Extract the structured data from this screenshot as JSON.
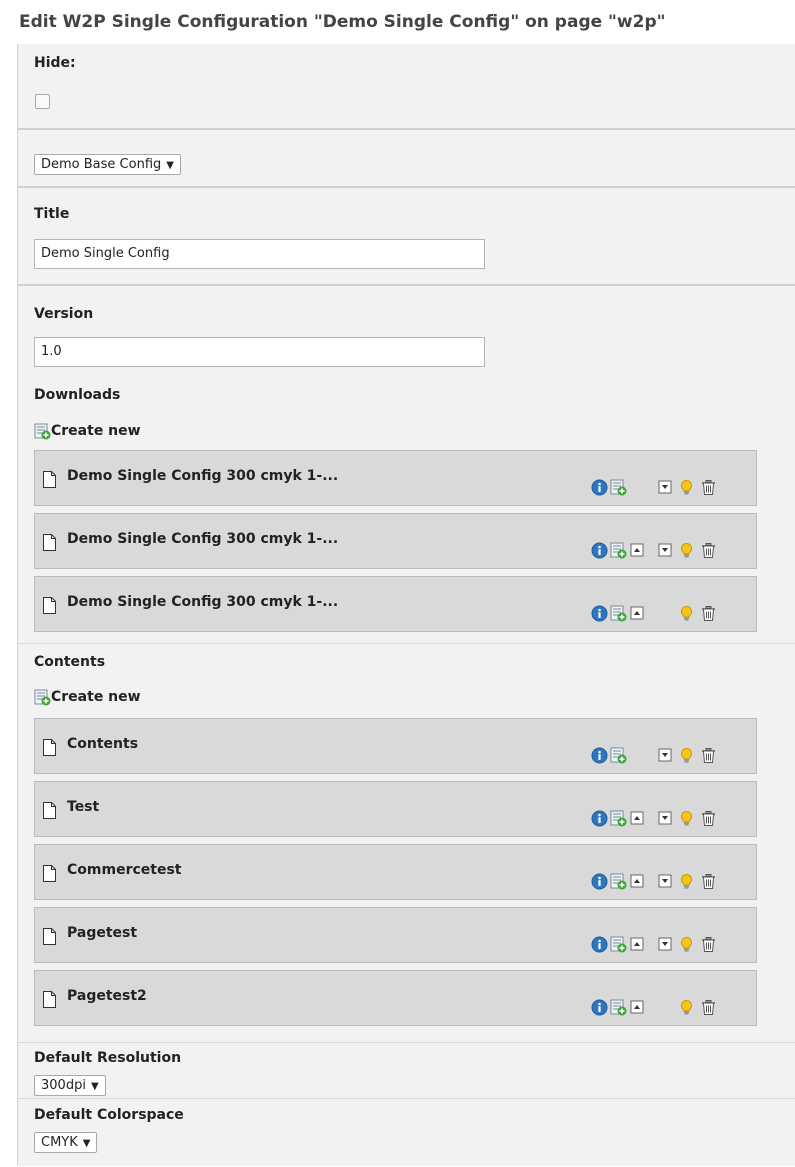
{
  "page": {
    "title": "Edit W2P Single Configuration \"Demo Single Config\" on page \"w2p\""
  },
  "hide": {
    "label": "Hide:",
    "checked": false
  },
  "base_config": {
    "value": "Demo Base Config"
  },
  "title_field": {
    "label": "Title",
    "value": "Demo Single Config"
  },
  "version_field": {
    "label": "Version",
    "value": "1.0"
  },
  "downloads": {
    "label": "Downloads",
    "create_label": "Create new",
    "items": [
      {
        "title": "Demo Single Config 300 cmyk 1-...",
        "controls": [
          "info",
          "new-record",
          "move-down",
          "hide",
          "delete"
        ]
      },
      {
        "title": "Demo Single Config 300 cmyk 1-...",
        "controls": [
          "info",
          "new-record",
          "move-up",
          "move-down",
          "hide",
          "delete"
        ]
      },
      {
        "title": "Demo Single Config 300 cmyk 1-...",
        "controls": [
          "info",
          "new-record",
          "move-up",
          "hide",
          "delete"
        ]
      }
    ]
  },
  "contents": {
    "label": "Contents",
    "create_label": "Create new",
    "items": [
      {
        "title": "Contents",
        "controls": [
          "info",
          "new-record",
          "move-down",
          "hide",
          "delete"
        ]
      },
      {
        "title": "Test",
        "controls": [
          "info",
          "new-record",
          "move-up",
          "move-down",
          "hide",
          "delete"
        ]
      },
      {
        "title": "Commercetest",
        "controls": [
          "info",
          "new-record",
          "move-up",
          "move-down",
          "hide",
          "delete"
        ]
      },
      {
        "title": "Pagetest",
        "controls": [
          "info",
          "new-record",
          "move-up",
          "move-down",
          "hide",
          "delete"
        ]
      },
      {
        "title": "Pagetest2",
        "controls": [
          "info",
          "new-record",
          "move-up",
          "hide",
          "delete"
        ]
      }
    ]
  },
  "default_resolution": {
    "label": "Default Resolution",
    "value": "300dpi"
  },
  "default_colorspace": {
    "label": "Default Colorspace",
    "value": "CMYK"
  },
  "colors": {
    "panel_bg": "#f2f2f2",
    "record_bg": "#d9d9d9",
    "info_blue": "#2f76c0",
    "bulb_yellow": "#f5c518",
    "plus_green": "#3aa635"
  },
  "icons": {
    "document": "document-icon",
    "new_record": "new-record-icon",
    "info": "info-icon",
    "move_up": "move-up-icon",
    "move_down": "move-down-icon",
    "hide": "lightbulb-icon",
    "delete": "trash-icon"
  }
}
